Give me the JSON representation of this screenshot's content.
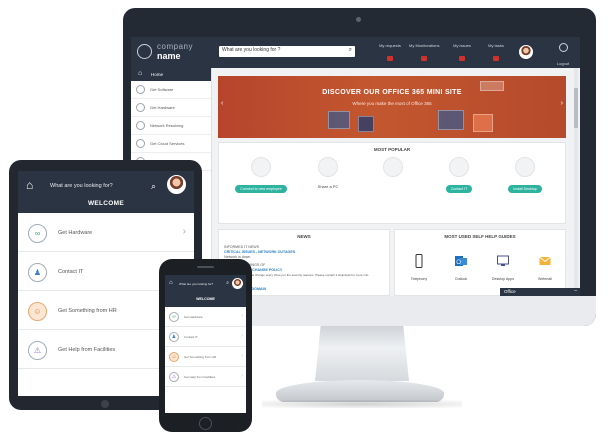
{
  "desktop": {
    "logo": {
      "line1": "company",
      "line2": "name"
    },
    "search": {
      "placeholder": "What are you looking for ?"
    },
    "nav": [
      {
        "label": "My requests",
        "count": "3"
      },
      {
        "label": "My Monitorations",
        "count": "3"
      },
      {
        "label": "My issues",
        "count": "3"
      },
      {
        "label": "My tasks",
        "count": "3"
      }
    ],
    "logout_label": "Logout",
    "sidebar": [
      "Home",
      "Get Software",
      "Get Hardware",
      "Network Resolving",
      "Get Cloud Services",
      "Get help"
    ],
    "hero": {
      "title": "DISCOVER OUR OFFICE 365 MINI SITE",
      "subtitle": "Where you make the most of Office 365"
    },
    "most_popular": {
      "title": "MOST POPULAR",
      "items": [
        {
          "type": "button",
          "label": "Connect to new employee"
        },
        {
          "type": "text",
          "label": "Share a PC"
        },
        {
          "type": "none",
          "label": ""
        },
        {
          "type": "button",
          "label": "Contact IT"
        },
        {
          "type": "button",
          "label": "Install Desktop"
        }
      ]
    },
    "news": {
      "title": "NEWS",
      "lines": [
        "INFORMED IT NEWS",
        "CRITICAL ISSUES - NETWORK OUTAGES",
        "Network is down",
        "IMPORTANT THINGS OF",
        "IT - PASSWORD CHANGE POLICY",
        "Passwords will now be change every three per the security reasons. Please contact it Helpdesk for more info.",
        "WEB",
        "IT - NEW PRINT DOMAIN"
      ]
    },
    "guides": {
      "title": "MOST USED SELF HELP GUIDES",
      "items": [
        "Telephony",
        "Outlook",
        "Desktop Apps",
        "Webmail"
      ]
    },
    "office_bar": "Office"
  },
  "tablet": {
    "search": {
      "placeholder": "What are you looking for?"
    },
    "welcome": "WELCOME",
    "items": [
      "Get Hardware",
      "Contact IT",
      "Get Something from HR",
      "Get Help from Facilities"
    ]
  },
  "phone": {
    "search": {
      "placeholder": "What are you looking for?"
    },
    "welcome": "WELCOME",
    "items": [
      "Get Hardware",
      "Contact IT",
      "Get Something from HR",
      "Get Help from Facilities"
    ]
  },
  "colors": {
    "header": "#2b3442",
    "hero": "#c3572f",
    "accent": "#2db39f",
    "badge": "#d0312d"
  },
  "icons": [
    "home-icon",
    "search-icon",
    "avatar",
    "chevron-right-icon",
    "hardware-icon",
    "contact-icon",
    "hr-icon",
    "facilities-icon",
    "phone-icon",
    "outlook-icon",
    "desktop-icon",
    "mail-icon"
  ]
}
